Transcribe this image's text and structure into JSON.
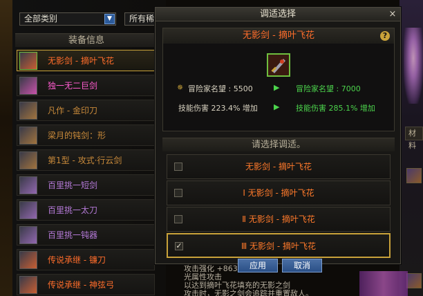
{
  "filters": {
    "category": "全部类别",
    "second": "所有稀"
  },
  "list_header": "装备信息",
  "items": [
    {
      "label": "无影剑 - 摘叶飞花",
      "color": "#ff6d2b",
      "selected": true,
      "icon": "sword-icon"
    },
    {
      "label": "独一无二巨剑",
      "color": "#ff5cd0",
      "selected": false,
      "icon": "greatsword-icon"
    },
    {
      "label": "凡作 - 金印刀",
      "color": "#c98a3a",
      "selected": false,
      "icon": "blade-icon"
    },
    {
      "label": "梁月的钝剑：形",
      "color": "#c98a3a",
      "selected": false,
      "icon": "bluntsword-icon"
    },
    {
      "label": "第1型 - 攻式·行云剑",
      "color": "#c98a3a",
      "selected": false,
      "icon": "sword-icon"
    },
    {
      "label": "百里挑一短剑",
      "color": "#b57ad8",
      "selected": false,
      "icon": "shortsword-icon"
    },
    {
      "label": "百里挑一太刀",
      "color": "#b57ad8",
      "selected": false,
      "icon": "katana-icon"
    },
    {
      "label": "百里挑一钝器",
      "color": "#b57ad8",
      "selected": false,
      "icon": "mace-icon"
    },
    {
      "label": "传说承继 - 镰刀",
      "color": "#ff6d2b",
      "selected": false,
      "icon": "scythe-icon"
    },
    {
      "label": "传说承继 - 神弦弓",
      "color": "#ff6d2b",
      "selected": false,
      "icon": "bow-icon"
    }
  ],
  "bg_lower_text": [
    "攻击强化 +863",
    "光属性攻击",
    "以达到摘叶飞花填充的无影之剑",
    "攻击时，无影之剑会追踪并重置敌人。"
  ],
  "bg_right_tab": "材料",
  "dialog": {
    "title": "调适选择",
    "close": "×",
    "item_name": "无影剑 - 摘叶飞花",
    "help": "?",
    "stats": [
      {
        "left": "冒险家名望 : 5500",
        "right": "冒险家名望 : 7000"
      },
      {
        "left": "技能伤害 223.4% 增加",
        "right": "技能伤害 285.1% 增加"
      }
    ],
    "arrow": "▶",
    "choice_header": "请选择调适。",
    "options": [
      {
        "label": "无影剑 - 摘叶飞花",
        "checked": false
      },
      {
        "label": "Ⅰ 无影剑 - 摘叶飞花",
        "checked": false
      },
      {
        "label": "Ⅱ 无影剑 - 摘叶飞花",
        "checked": false
      },
      {
        "label": "Ⅲ 无影剑 - 摘叶飞花",
        "checked": true
      }
    ],
    "apply": "应用",
    "cancel": "取消"
  },
  "colors": {
    "accent_gold": "#c9a23a",
    "epic_orange": "#ff6d2b",
    "stat_green": "#4cd44c"
  }
}
